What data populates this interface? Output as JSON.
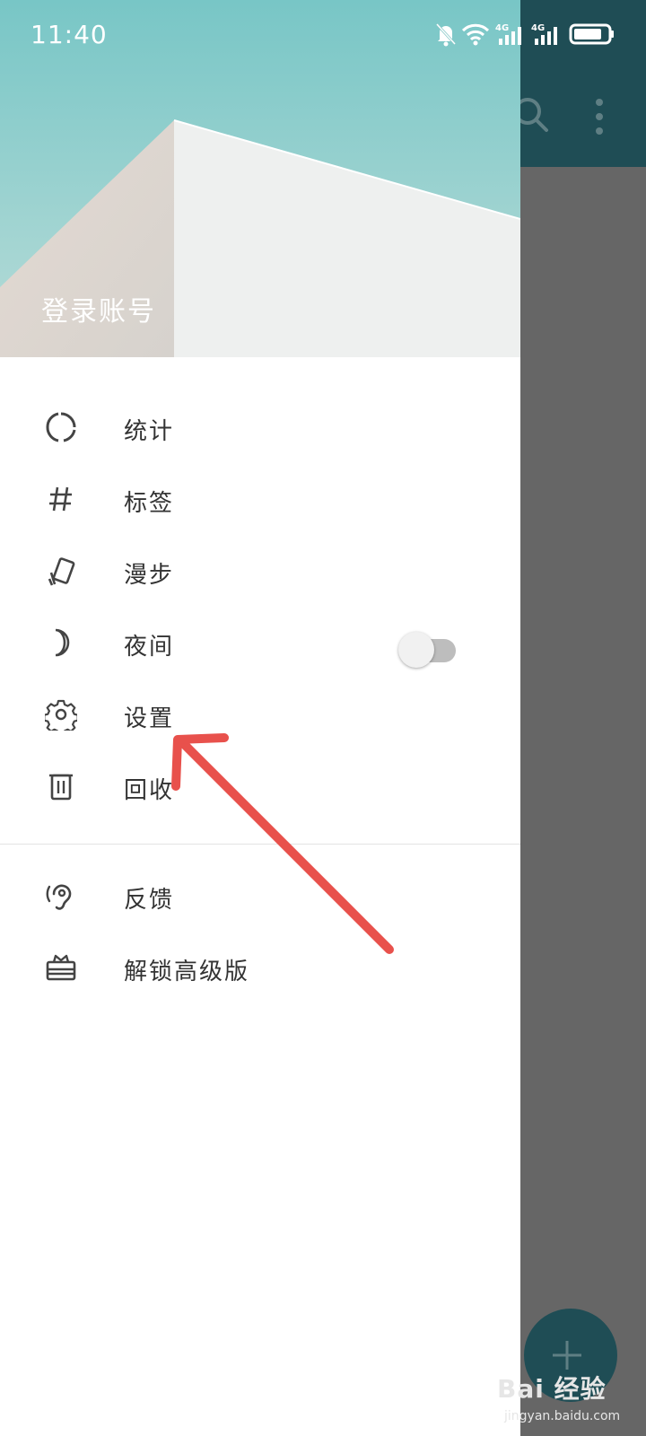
{
  "status_bar": {
    "time": "11:40",
    "icons": [
      "bell-off-icon",
      "wifi-icon",
      "signal-4g-icon",
      "signal-4g-icon",
      "battery-icon"
    ],
    "network_label": "4G"
  },
  "header": {
    "login_label": "登录账号"
  },
  "menu": {
    "items": [
      {
        "label": "统计",
        "icon": "stats-ring-icon"
      },
      {
        "label": "标签",
        "icon": "hashtag-icon"
      },
      {
        "label": "漫步",
        "icon": "cards-icon"
      },
      {
        "label": "夜间",
        "icon": "moon-icon",
        "toggle_on": false
      },
      {
        "label": "设置",
        "icon": "gear-icon"
      },
      {
        "label": "回收",
        "icon": "trash-icon"
      }
    ],
    "secondary_items": [
      {
        "label": "反馈",
        "icon": "ear-icon"
      },
      {
        "label": "解锁高级版",
        "icon": "gift-icon"
      }
    ]
  },
  "watermark": {
    "main": "Bai 经验",
    "sub": "jingyan.baidu.com"
  },
  "colors": {
    "toolbar": "#1f4d55",
    "dim_overlay": "#666666",
    "arrow": "#e8514c",
    "header_sky": "#7ec8c8"
  }
}
